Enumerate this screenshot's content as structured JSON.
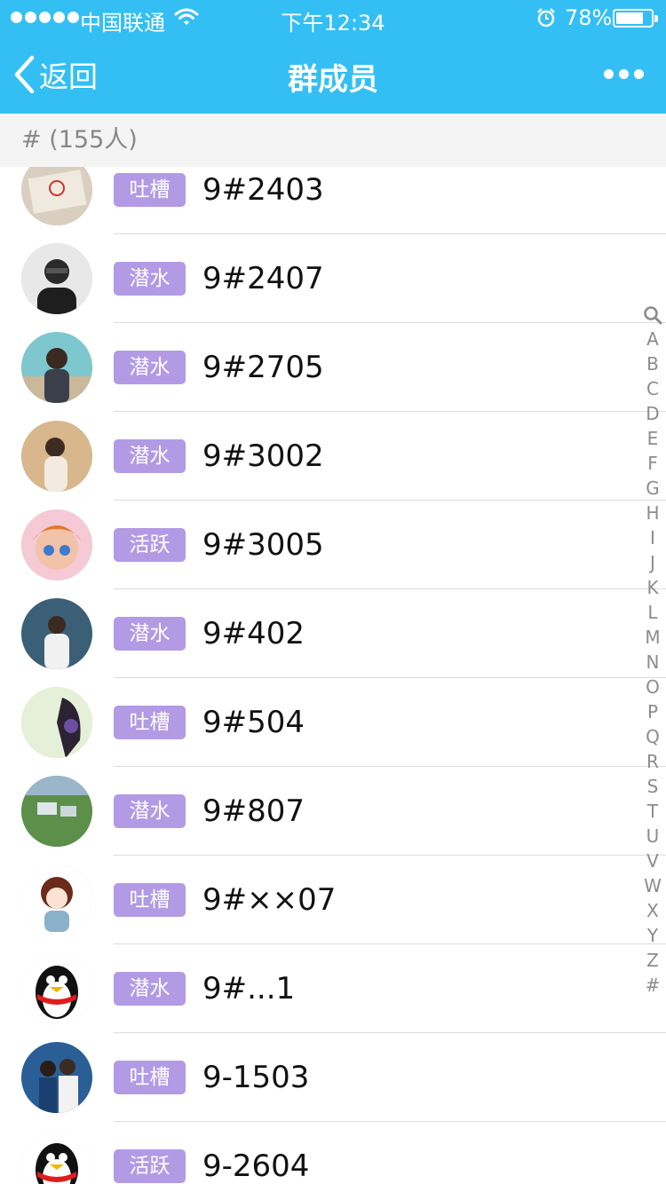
{
  "status_bar": {
    "carrier": "中国联通",
    "time": "下午12:34",
    "battery_percent": "78%",
    "battery_level": 0.78
  },
  "nav": {
    "back_label": "返回",
    "title": "群成员"
  },
  "section": {
    "header": "# (155人)"
  },
  "members": [
    {
      "badge": "吐槽",
      "name": "9#2403"
    },
    {
      "badge": "潜水",
      "name": "9#2407"
    },
    {
      "badge": "潜水",
      "name": "9#2705"
    },
    {
      "badge": "潜水",
      "name": "9#3002"
    },
    {
      "badge": "活跃",
      "name": "9#3005"
    },
    {
      "badge": "潜水",
      "name": "9#402"
    },
    {
      "badge": "吐槽",
      "name": "9#504"
    },
    {
      "badge": "潜水",
      "name": "9#807"
    },
    {
      "badge": "吐槽",
      "name": "9#××07"
    },
    {
      "badge": "潜水",
      "name": "9#...1"
    },
    {
      "badge": "吐槽",
      "name": "9-1503"
    },
    {
      "badge": "活跃",
      "name": "9-2604"
    }
  ],
  "index_letters": [
    "A",
    "B",
    "C",
    "D",
    "E",
    "F",
    "G",
    "H",
    "I",
    "J",
    "K",
    "L",
    "M",
    "N",
    "O",
    "P",
    "Q",
    "R",
    "S",
    "T",
    "U",
    "V",
    "W",
    "X",
    "Y",
    "Z",
    "#"
  ],
  "colors": {
    "header_blue": "#33bff3",
    "badge_purple": "#b29ae4",
    "section_bg": "#f4f4f4"
  }
}
